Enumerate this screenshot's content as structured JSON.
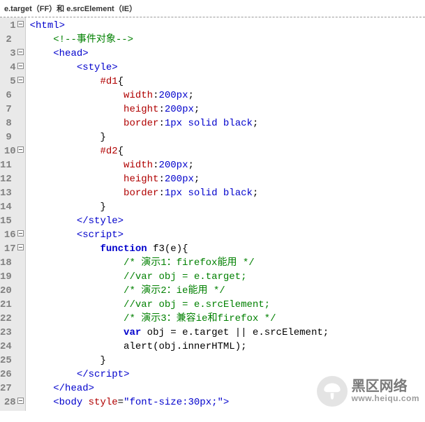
{
  "header": "e.target（FF）和 e.srcElement（IE）",
  "gutter": {
    "lines": [
      "1",
      "2",
      "3",
      "4",
      "5",
      "6",
      "7",
      "8",
      "9",
      "10",
      "11",
      "12",
      "13",
      "14",
      "15",
      "16",
      "17",
      "18",
      "19",
      "20",
      "21",
      "22",
      "23",
      "24",
      "25",
      "26",
      "27",
      "28"
    ],
    "fold_marker": "−"
  },
  "code": {
    "l1": {
      "a": "<",
      "b": "html",
      "c": ">"
    },
    "l2": {
      "a": "<!--",
      "b": "事件对象",
      "c": "-->"
    },
    "l3": {
      "a": "<",
      "b": "head",
      "c": ">"
    },
    "l4": {
      "a": "<",
      "b": "style",
      "c": ">"
    },
    "l5": {
      "sel": "#d1",
      "b": "{"
    },
    "l6": {
      "p": "width",
      "c": ":",
      "v": "200px",
      "e": ";"
    },
    "l7": {
      "p": "height",
      "c": ":",
      "v": "200px",
      "e": ";"
    },
    "l8": {
      "p": "border",
      "c": ":",
      "v": "1px solid black",
      "e": ";"
    },
    "l9": {
      "b": "}"
    },
    "l10": {
      "sel": "#d2",
      "b": "{"
    },
    "l11": {
      "p": "width",
      "c": ":",
      "v": "200px",
      "e": ";"
    },
    "l12": {
      "p": "height",
      "c": ":",
      "v": "200px",
      "e": ";"
    },
    "l13": {
      "p": "border",
      "c": ":",
      "v": "1px solid black",
      "e": ";"
    },
    "l14": {
      "b": "}"
    },
    "l15": {
      "a": "</",
      "b": "style",
      "c": ">"
    },
    "l16": {
      "a": "<",
      "b": "script",
      "c": ">"
    },
    "l17": {
      "k": "function",
      "n": " f3",
      "a": "(",
      "p": "e",
      "b": "){"
    },
    "l18": {
      "c": "/* 演示1：firefox能用 */"
    },
    "l19": {
      "c": "//var obj = e.target;"
    },
    "l20": {
      "c": "/* 演示2：ie能用 */"
    },
    "l21": {
      "c": "//var obj = e.srcElement;"
    },
    "l22": {
      "c": "/* 演示3：兼容ie和firefox */"
    },
    "l23": {
      "k": "var",
      "a": " obj ",
      "eq": "=",
      "b": " e",
      "d": ".",
      "t": "target ",
      "op": "||",
      "c2": " e",
      "d2": ".",
      "s": "srcElement",
      "e": ";"
    },
    "l24": {
      "fn": "alert",
      "a": "(",
      "o": "obj",
      "d": ".",
      "p": "innerHTML",
      "b": ")",
      "e": ";"
    },
    "l25": {
      "b": "}"
    },
    "l26": {
      "a": "</",
      "b": "script",
      "c": ">"
    },
    "l27": {
      "a": "</",
      "b": "head",
      "c": ">"
    },
    "l28": {
      "a": "<",
      "b": "body ",
      "at": "style",
      "eq": "=",
      "q": "\"",
      "v": "font-size:30px;",
      "q2": "\"",
      "c": ">"
    }
  },
  "watermark": {
    "icon": "mushroom-icon",
    "line1": "黑区网络",
    "line2": "www.heiqu.com"
  }
}
